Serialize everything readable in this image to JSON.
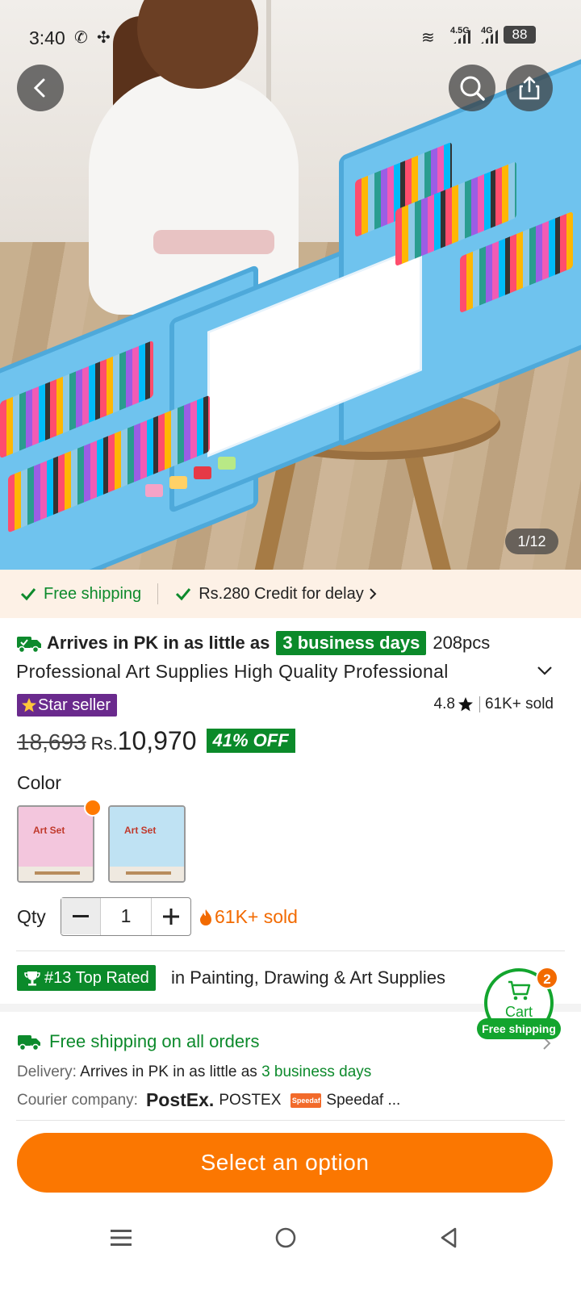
{
  "status_bar": {
    "time": "3:40",
    "network_1": "4.5G",
    "network_2": "4G",
    "battery": "88"
  },
  "gallery": {
    "counter": "1/12"
  },
  "benefits": {
    "free_shipping": "Free shipping",
    "credit": "Rs.280 Credit for delay"
  },
  "product": {
    "arrives_prefix": "Arrives in PK in as little as",
    "arrives_days": "3 business days",
    "title_line1_rest": "208pcs",
    "title_line2": "Professional Art Supplies High Quality Professional",
    "star_seller": "Star seller",
    "rating": "4.8",
    "sold": "61K+ sold",
    "old_price": "18,693",
    "currency": "Rs.",
    "price": "10,970",
    "discount": "41% OFF",
    "color_label": "Color",
    "swatches": [
      {
        "name": "Pink Art Set",
        "title": "Art Set",
        "color": "#f3c6dd"
      },
      {
        "name": "Blue Art Set",
        "title": "Art Set",
        "color": "#bfe2f3"
      }
    ],
    "qty_label": "Qty",
    "qty_value": "1",
    "qty_sold": "61K+ sold",
    "top_rated_badge": "#13 Top Rated",
    "top_rated_category": "in Painting, Drawing & Art Supplies"
  },
  "shipping": {
    "title": "Free shipping on all orders",
    "delivery_label": "Delivery:",
    "delivery_text": "Arrives in PK in as little as",
    "delivery_days": "3 business days",
    "courier_label": "Courier company:",
    "postex_logo": "PostEx.",
    "postex_name": "POSTEX",
    "speedaf_logo": "Speedaf",
    "speedaf_name": "Speedaf ..."
  },
  "cart": {
    "label": "Cart",
    "count": "2",
    "free_shipping": "Free shipping"
  },
  "cta": {
    "select_option": "Select an option"
  },
  "colors": {
    "accent_orange": "#fb7701",
    "green": "#0b8a2a",
    "star_seller_purple": "#6a2a8d"
  }
}
